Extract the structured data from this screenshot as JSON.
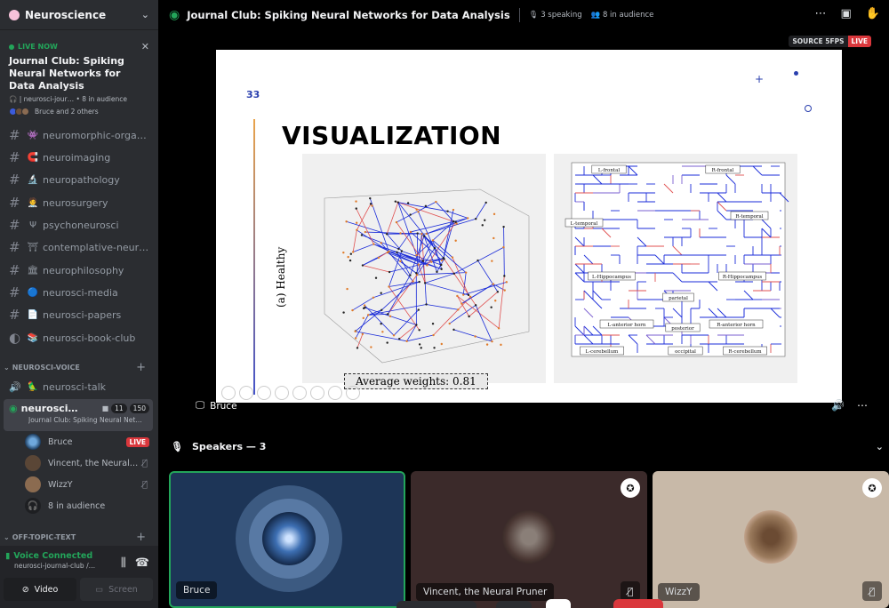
{
  "server": {
    "name": "Neuroscience",
    "icon": "flower-icon"
  },
  "live_card": {
    "live_label": "LIVE NOW",
    "title": "Journal Club: Spiking Neural Networks for Data Analysis",
    "meta": "| neurosci-jour… • 8 in audience",
    "users": "Bruce and 2 others"
  },
  "channels": [
    {
      "emoji": "👾",
      "name": "neuromorphic-orga…"
    },
    {
      "emoji": "🧲",
      "name": "neuroimaging"
    },
    {
      "emoji": "🔬",
      "name": "neuropathology"
    },
    {
      "emoji": "🧑‍⚕️",
      "name": "neurosurgery"
    },
    {
      "emoji": "Ψ",
      "name": "psychoneurosci"
    },
    {
      "emoji": "⛩",
      "name": "contemplative-neur…"
    },
    {
      "emoji": "🏛",
      "name": "neurophilosophy"
    },
    {
      "emoji": "🔵",
      "name": "neurosci-media"
    },
    {
      "emoji": "📄",
      "name": "neurosci-papers"
    },
    {
      "emoji": "📚",
      "name": "neurosci-book-club"
    }
  ],
  "voice_category": "NEUROSCI-VOICE",
  "voice_channel_1": {
    "emoji": "🦜",
    "name": "neurosci-talk"
  },
  "active_voice": {
    "name": "neurosci…",
    "video_count": "11",
    "audience_count": "150",
    "subtitle": "Journal Club: Spiking Neural Net…"
  },
  "members": [
    {
      "name": "Bruce",
      "live": "LIVE"
    },
    {
      "name": "Vincent, the Neural…"
    },
    {
      "name": "WizzY"
    },
    {
      "name": "8 in audience"
    }
  ],
  "offtopic_category": "OFF-TOPIC-TEXT",
  "voice_panel": {
    "status": "Voice Connected",
    "channel": "neurosci-journal-club /…",
    "video_label": "Video",
    "screen_label": "Screen"
  },
  "topbar": {
    "title": "Journal Club: Spiking Neural Networks for Data Analysis",
    "speaking": "3 speaking",
    "audience": "8 in audience"
  },
  "stream": {
    "source_badge": "SOURCE 5FPS",
    "live_badge": "LIVE",
    "streamer": "Bruce"
  },
  "slide": {
    "number": "33",
    "title": "VISUALIZATION",
    "healthy_label": "(a) Healthy",
    "avg_weights": "Average weights: 0.81",
    "right_labels": [
      "L-frontal",
      "R-frontal",
      "L-temporal",
      "R-temporal",
      "L-Hippocampus",
      "R-Hippocampus",
      "parietal",
      "L-anterior horn",
      "posterior",
      "R-anterior horn",
      "occipital",
      "L-cerebellum",
      "R-cerebellum"
    ]
  },
  "speakers": {
    "header": "Speakers — 3",
    "tiles": [
      {
        "name": "Bruce"
      },
      {
        "name": "Vincent, the Neural Pruner"
      },
      {
        "name": "WizzY"
      }
    ]
  },
  "colors": {
    "live_green": "#23a55a",
    "live_red": "#da373c",
    "sidebar_bg": "#2b2d31",
    "accent_blue": "#2a3fae"
  }
}
